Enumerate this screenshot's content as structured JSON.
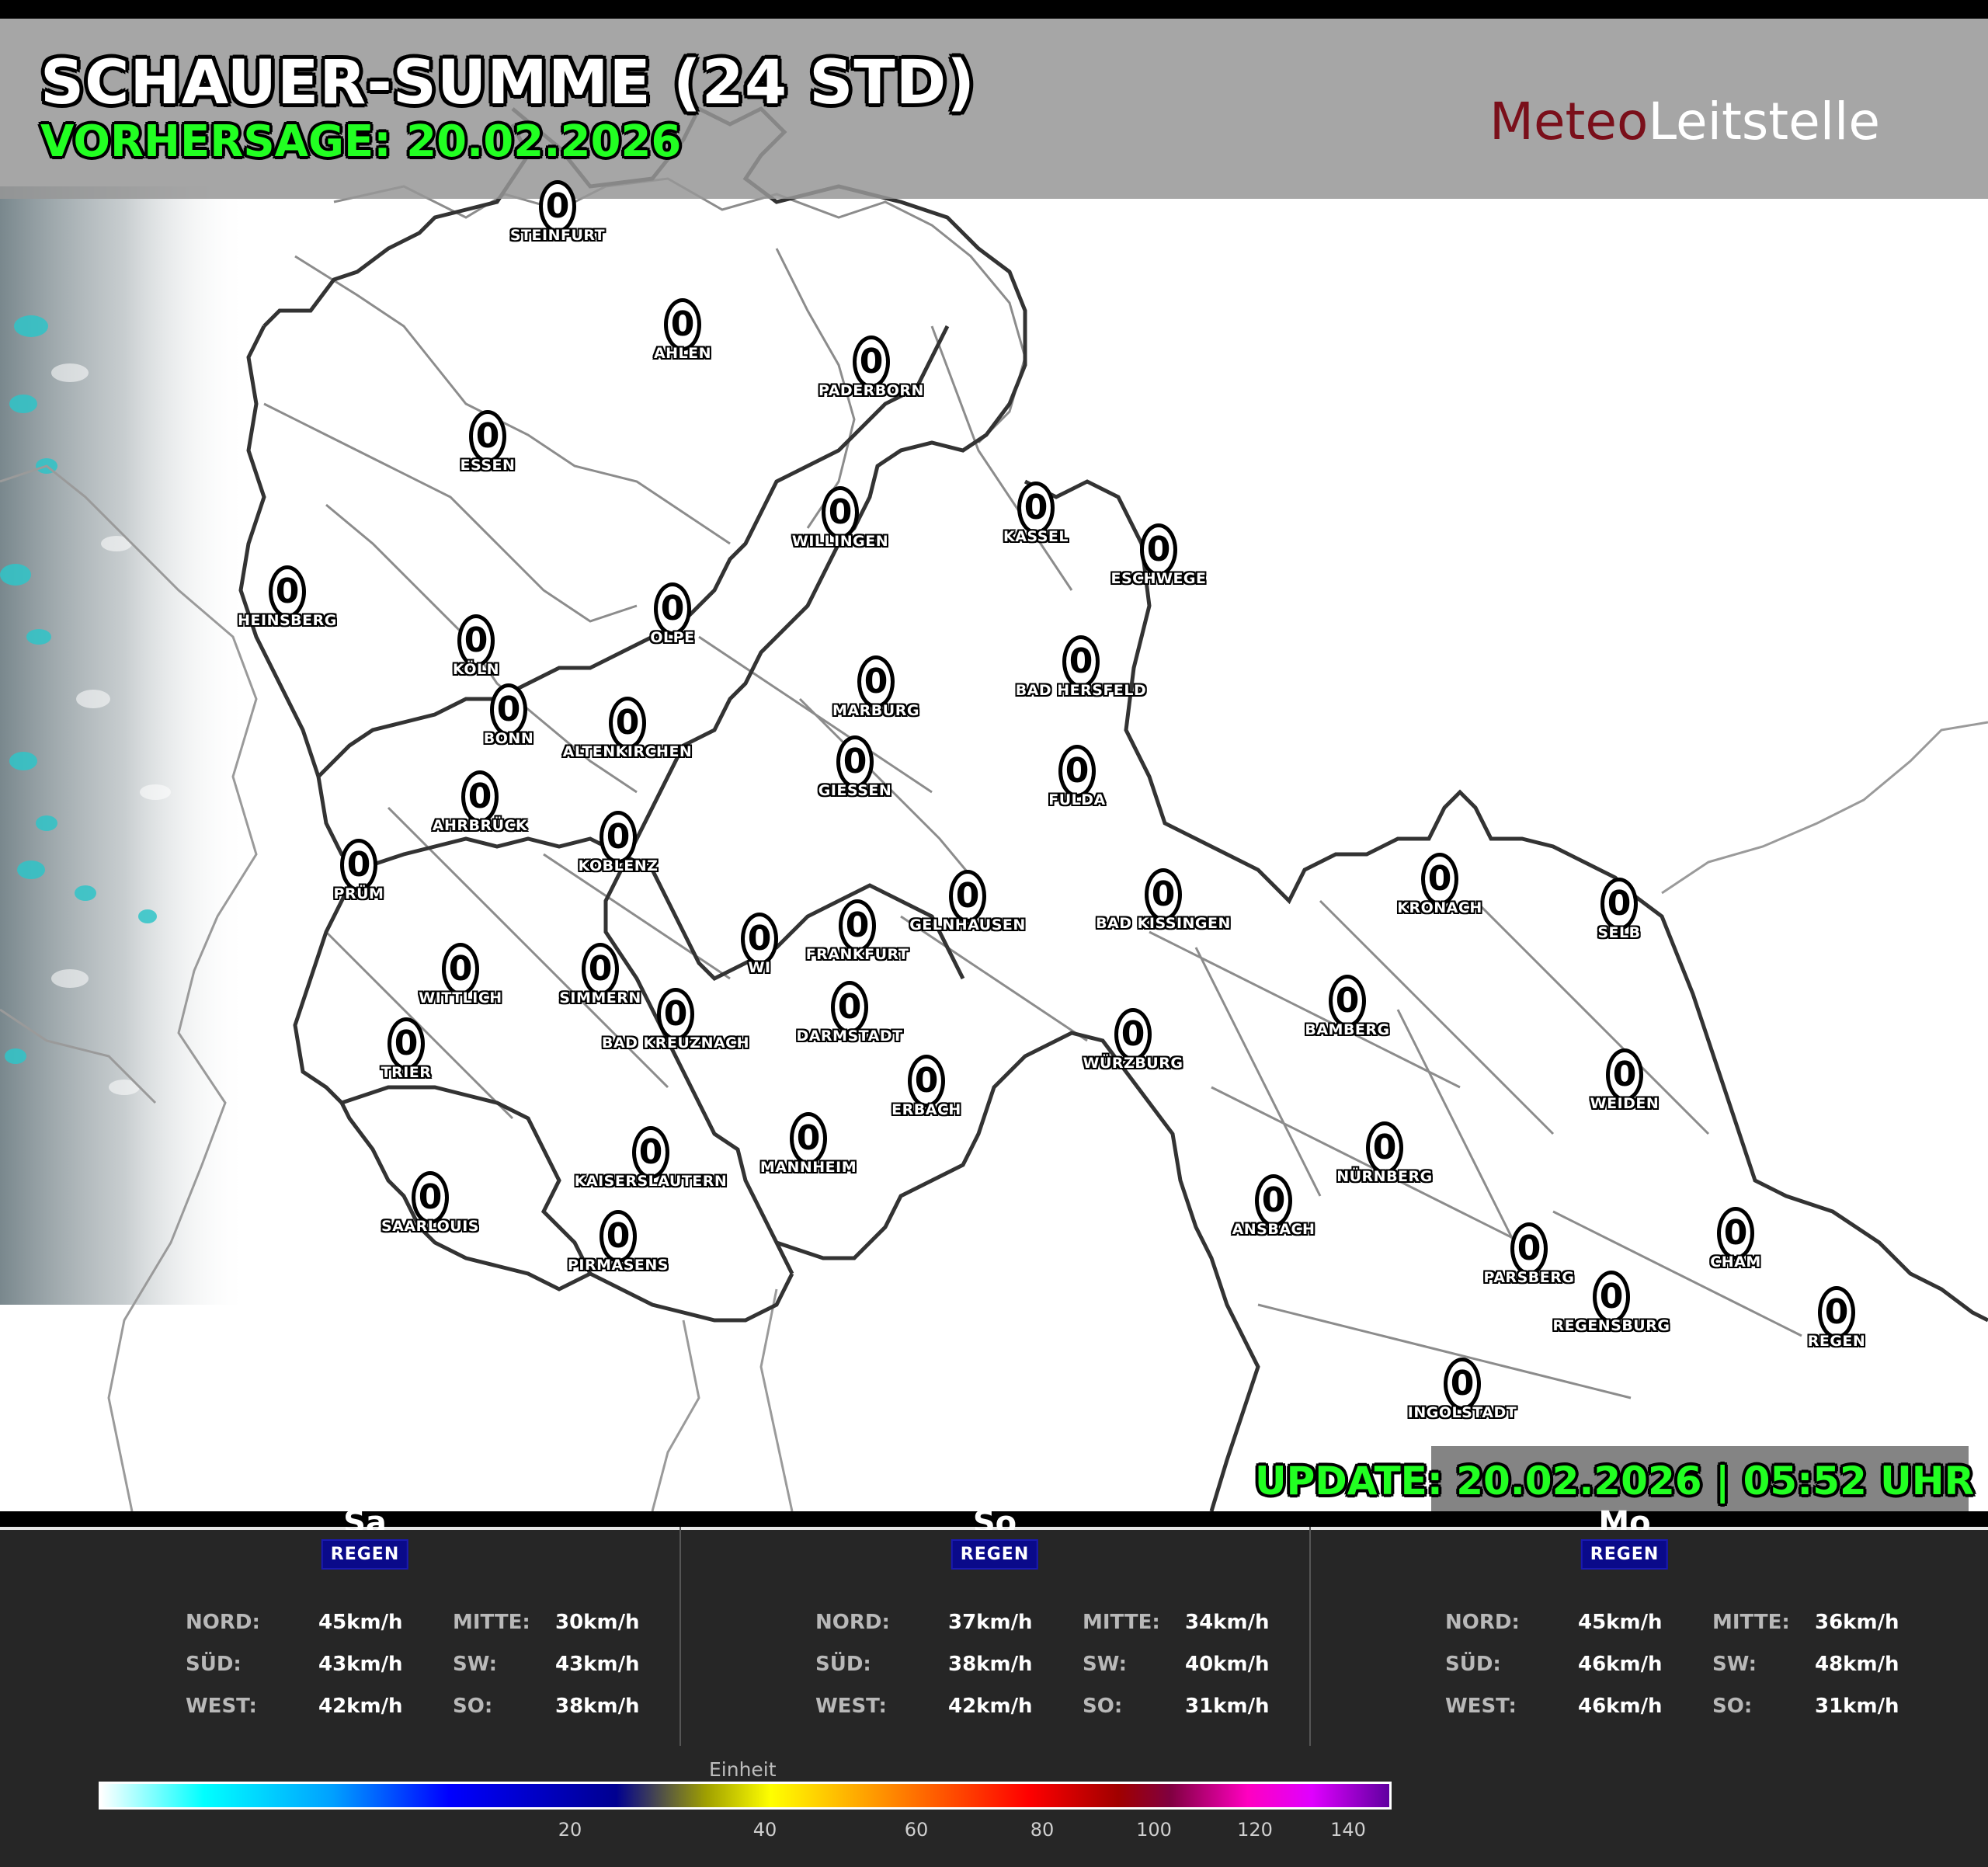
{
  "header": {
    "title": "SCHAUER-SUMME (24 STD)",
    "subtitle": "VORHERSAGE: 20.02.2026",
    "logo_part1": "Meteo",
    "logo_part2": "Leitstelle",
    "logo_color1": "#7a0f1a",
    "logo_color2": "#ffffff"
  },
  "update": "UPDATE: 20.02.2026 | 05:52 UHR",
  "cities": [
    {
      "name": "STEINFURT",
      "value": "0"
    },
    {
      "name": "AHLEN",
      "value": "0"
    },
    {
      "name": "PADERBORN",
      "value": "0"
    },
    {
      "name": "ESSEN",
      "value": "0"
    },
    {
      "name": "WILLINGEN",
      "value": "0"
    },
    {
      "name": "KASSEL",
      "value": "0"
    },
    {
      "name": "ESCHWEGE",
      "value": "0"
    },
    {
      "name": "HEINSBERG",
      "value": "0"
    },
    {
      "name": "KÖLN",
      "value": "0"
    },
    {
      "name": "OLPE",
      "value": "0"
    },
    {
      "name": "BAD HERSFELD",
      "value": "0"
    },
    {
      "name": "MARBURG",
      "value": "0"
    },
    {
      "name": "BONN",
      "value": "0"
    },
    {
      "name": "ALTENKIRCHEN",
      "value": "0"
    },
    {
      "name": "GIESSEN",
      "value": "0"
    },
    {
      "name": "FULDA",
      "value": "0"
    },
    {
      "name": "AHRBRÜCK",
      "value": "0"
    },
    {
      "name": "KOBLENZ",
      "value": "0"
    },
    {
      "name": "PRÜM",
      "value": "0"
    },
    {
      "name": "GELNHAUSEN",
      "value": "0"
    },
    {
      "name": "BAD KISSINGEN",
      "value": "0"
    },
    {
      "name": "KRONACH",
      "value": "0"
    },
    {
      "name": "SELB",
      "value": "0"
    },
    {
      "name": "WI",
      "value": "0"
    },
    {
      "name": "FRANKFURT",
      "value": "0"
    },
    {
      "name": "WITTLICH",
      "value": "0"
    },
    {
      "name": "SIMMERN",
      "value": "0"
    },
    {
      "name": "BAMBERG",
      "value": "0"
    },
    {
      "name": "DARMSTADT",
      "value": "0"
    },
    {
      "name": "BAD KREUZNACH",
      "value": "0"
    },
    {
      "name": "TRIER",
      "value": "0"
    },
    {
      "name": "WÜRZBURG",
      "value": "0"
    },
    {
      "name": "ERBACH",
      "value": "0"
    },
    {
      "name": "WEIDEN",
      "value": "0"
    },
    {
      "name": "KAISERSLAUTERN",
      "value": "0"
    },
    {
      "name": "MANNHEIM",
      "value": "0"
    },
    {
      "name": "NÜRNBERG",
      "value": "0"
    },
    {
      "name": "SAARLOUIS",
      "value": "0"
    },
    {
      "name": "ANSBACH",
      "value": "0"
    },
    {
      "name": "CHAM",
      "value": "0"
    },
    {
      "name": "PIRMASENS",
      "value": "0"
    },
    {
      "name": "PARSBERG",
      "value": "0"
    },
    {
      "name": "REGENSBURG",
      "value": "0"
    },
    {
      "name": "REGEN",
      "value": "0"
    },
    {
      "name": "INGOLSTADT",
      "value": "0"
    }
  ],
  "days": [
    {
      "name": "Sa",
      "badge": "REGEN",
      "rows": [
        {
          "k1": "NORD:",
          "v1": "45km/h",
          "k2": "MITTE:",
          "v2": "30km/h"
        },
        {
          "k1": "SÜD:",
          "v1": "43km/h",
          "k2": "SW:",
          "v2": "43km/h"
        },
        {
          "k1": "WEST:",
          "v1": "42km/h",
          "k2": "SO:",
          "v2": "38km/h"
        }
      ]
    },
    {
      "name": "So",
      "badge": "REGEN",
      "rows": [
        {
          "k1": "NORD:",
          "v1": "37km/h",
          "k2": "MITTE:",
          "v2": "34km/h"
        },
        {
          "k1": "SÜD:",
          "v1": "38km/h",
          "k2": "SW:",
          "v2": "40km/h"
        },
        {
          "k1": "WEST:",
          "v1": "42km/h",
          "k2": "SO:",
          "v2": "31km/h"
        }
      ]
    },
    {
      "name": "Mo",
      "badge": "REGEN",
      "rows": [
        {
          "k1": "NORD:",
          "v1": "45km/h",
          "k2": "MITTE:",
          "v2": "36km/h"
        },
        {
          "k1": "SÜD:",
          "v1": "46km/h",
          "k2": "SW:",
          "v2": "48km/h"
        },
        {
          "k1": "WEST:",
          "v1": "46km/h",
          "k2": "SO:",
          "v2": "31km/h"
        }
      ]
    }
  ],
  "colorbar": {
    "title": "Einheit",
    "ticks": [
      "20",
      "40",
      "60",
      "80",
      "100",
      "120",
      "140"
    ]
  }
}
